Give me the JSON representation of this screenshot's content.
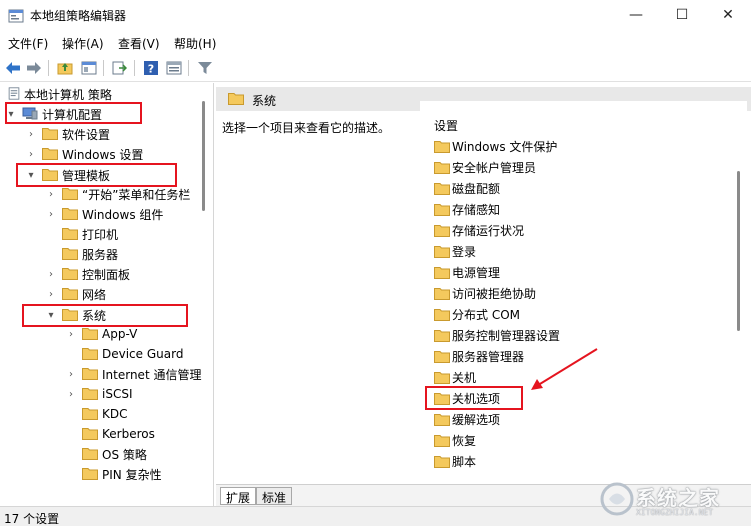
{
  "window": {
    "title": "本地组策略编辑器",
    "minimize": "—",
    "maximize": "☐",
    "close": "✕"
  },
  "menu": [
    "文件(F)",
    "操作(A)",
    "查看(V)",
    "帮助(H)"
  ],
  "toolbar": {
    "icons": [
      "back-arrow-icon",
      "forward-arrow-icon",
      "up-folder-icon",
      "show-tree-icon",
      "export-list-icon",
      "help-icon",
      "properties-icon",
      "filter-icon"
    ]
  },
  "tree": {
    "root": "本地计算机 策略",
    "items": [
      {
        "label": "计算机配置",
        "chev": "▾"
      },
      {
        "label": "软件设置",
        "chev": "›"
      },
      {
        "label": "Windows 设置",
        "chev": "›"
      },
      {
        "label": "管理模板",
        "chev": "▾"
      },
      {
        "label": "“开始”菜单和任务栏",
        "chev": "›"
      },
      {
        "label": "Windows 组件",
        "chev": "›"
      },
      {
        "label": "打印机",
        "chev": ""
      },
      {
        "label": "服务器",
        "chev": ""
      },
      {
        "label": "控制面板",
        "chev": "›"
      },
      {
        "label": "网络",
        "chev": "›"
      },
      {
        "label": "系统",
        "chev": "▾"
      },
      {
        "label": "App-V",
        "chev": "›"
      },
      {
        "label": "Device Guard",
        "chev": ""
      },
      {
        "label": "Internet 通信管理",
        "chev": "›"
      },
      {
        "label": "iSCSI",
        "chev": "›"
      },
      {
        "label": "KDC",
        "chev": ""
      },
      {
        "label": "Kerberos",
        "chev": ""
      },
      {
        "label": "OS 策略",
        "chev": ""
      },
      {
        "label": "PIN 复杂性",
        "chev": ""
      }
    ]
  },
  "right_pane": {
    "header": "系统",
    "description": "选择一个项目来查看它的描述。",
    "column_header": "设置",
    "items": [
      "Windows 文件保护",
      "安全帐户管理员",
      "磁盘配额",
      "存储感知",
      "存储运行状况",
      "登录",
      "电源管理",
      "访问被拒绝协助",
      "分布式 COM",
      "服务控制管理器设置",
      "服务器管理器",
      "关机",
      "关机选项",
      "缓解选项",
      "恢复",
      "脚本"
    ]
  },
  "tabs": [
    "扩展",
    "标准"
  ],
  "status": "17 个设置",
  "watermark": {
    "text": "系统之家",
    "sub": "XITONGZHIJIA.NET"
  },
  "colors": {
    "highlight": "#e5141f",
    "folder": "#f4c95d"
  }
}
